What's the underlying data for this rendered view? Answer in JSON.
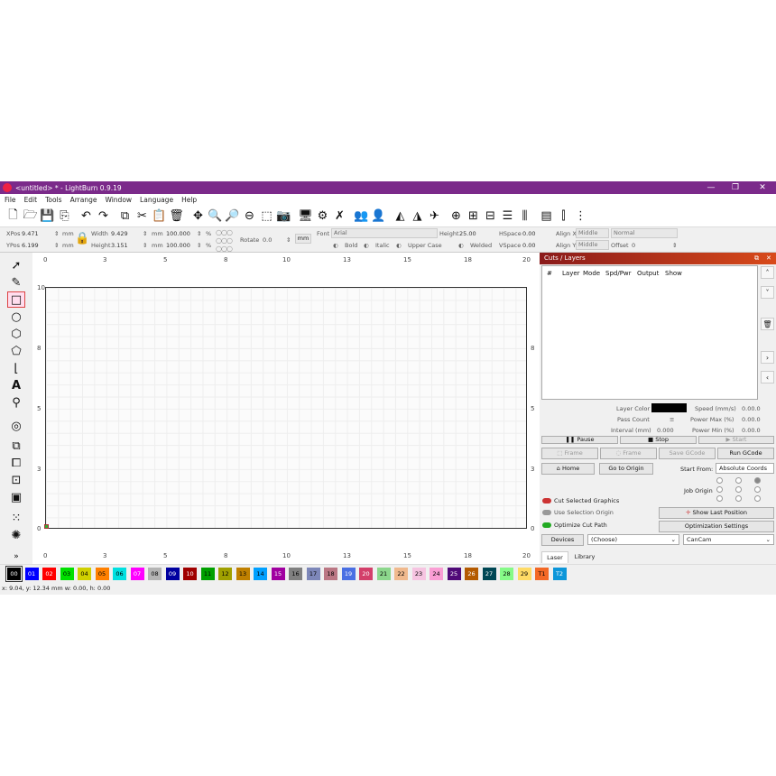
{
  "window": {
    "title": "<untitled> * - LightBurn 0.9.19",
    "minimize": "—",
    "restore": "❐",
    "close": "✕"
  },
  "menu": [
    "File",
    "Edit",
    "Tools",
    "Arrange",
    "Window",
    "Language",
    "Help"
  ],
  "toolbar_icons": [
    "new-file-icon",
    "open-folder-icon",
    "save-icon",
    "save-as-icon",
    "undo-icon",
    "redo-icon",
    "copy-icon",
    "cut-icon",
    "paste-icon",
    "delete-icon",
    "move-icon",
    "zoom-in-icon",
    "zoom-out-icon",
    "zoom-fit-icon",
    "zoom-frame-icon",
    "camera-icon",
    "monitor-icon",
    "settings-icon",
    "tools-icon",
    "users-icon",
    "user-icon",
    "mirror-h-icon",
    "mirror-v-icon",
    "send-icon",
    "target-icon",
    "align-icon",
    "distribute-icon",
    "align-center-icon",
    "align-middle-icon",
    "group-icon",
    "dock-icon",
    "center-icon"
  ],
  "props": {
    "xpos_label": "XPos",
    "xpos": "9.471",
    "ypos_label": "YPos",
    "ypos": "6.199",
    "unit": "mm",
    "width_label": "Width",
    "width": "9.429",
    "height_label": "Height",
    "height": "3.151",
    "scale_w": "100.000",
    "scale_h": "100.000",
    "pct": "%",
    "rotate_label": "Rotate",
    "rotate": "0.0",
    "unit_button": "mm",
    "font_label": "Font",
    "font": "Arial",
    "text_height_label": "Height",
    "text_height": "25.00",
    "hspace_label": "HSpace",
    "hspace": "0.00",
    "vspace_label": "VSpace",
    "vspace": "0.00",
    "alignx_label": "Align X",
    "alignx": "Middle",
    "aligny_label": "Align Y",
    "aligny": "Middle",
    "normal": "Normal",
    "offset_label": "Offset",
    "offset": "0",
    "bold": "Bold",
    "italic": "Italic",
    "upper": "Upper Case",
    "welded": "Welded"
  },
  "left_tools": [
    "select-icon",
    "edit-nodes-icon",
    "rectangle-icon",
    "ellipse-icon",
    "polygon-icon",
    "pentagon-icon",
    "bracket-icon",
    "text-icon",
    "position-icon",
    "offset-icon",
    "boolean-union-icon",
    "boolean-diff-icon",
    "boolean-intersect-icon",
    "weld-icon",
    "grid-array-icon",
    "circular-array-icon",
    "more-icon"
  ],
  "ruler_top": [
    "0",
    "3",
    "5",
    "8",
    "10",
    "13",
    "15",
    "18",
    "20"
  ],
  "ruler_bottom": [
    "0",
    "3",
    "5",
    "8",
    "10",
    "13",
    "15",
    "18",
    "20"
  ],
  "ruler_left": [
    "10",
    "8",
    "5",
    "3",
    "0"
  ],
  "ruler_right": [
    "8",
    "5",
    "3",
    "0"
  ],
  "cuts": {
    "title": "Cuts / Layers",
    "columns": [
      "#",
      "Layer",
      "Mode",
      "Spd/Pwr",
      "Output",
      "Show"
    ],
    "layer_color": "Layer Color",
    "pass_count": "Pass Count",
    "pass_val": "≡",
    "interval": "Interval (mm)",
    "interval_val": "0.000",
    "speed": "Speed (mm/s)",
    "speed_val": "0.00.0",
    "pmax": "Power Max (%)",
    "pmax_val": "0.00.0",
    "pmin": "Power Min (%)",
    "pmin_val": "0.00.0",
    "pause": "Pause",
    "stop": "Stop",
    "start": "Start",
    "frame1": "Frame",
    "frame2": "Frame",
    "save_gcode": "Save GCode",
    "run_gcode": "Run GCode",
    "home": "Home",
    "goto_origin": "Go to Origin",
    "start_from": "Start From:",
    "start_from_val": "Absolute Coords",
    "job_origin": "Job Origin",
    "cut_selected": "Cut Selected Graphics",
    "use_selection": "Use Selection Origin",
    "optimize": "Optimize Cut Path",
    "show_last": "Show Last Position",
    "opt_settings": "Optimization Settings",
    "devices": "Devices",
    "choose": "(Choose)",
    "device_name": "CanCam",
    "tab_laser": "Laser",
    "tab_library": "Library"
  },
  "palette": [
    {
      "label": "00",
      "color": "#000000",
      "text": "#ffffff"
    },
    {
      "label": "01",
      "color": "#0000ff",
      "text": "#ffffff"
    },
    {
      "label": "02",
      "color": "#ff0000",
      "text": "#ffffff"
    },
    {
      "label": "03",
      "color": "#00e000",
      "text": "#000000"
    },
    {
      "label": "04",
      "color": "#d0d000",
      "text": "#000000"
    },
    {
      "label": "05",
      "color": "#ff8000",
      "text": "#000000"
    },
    {
      "label": "06",
      "color": "#00e0e0",
      "text": "#000000"
    },
    {
      "label": "07",
      "color": "#ff00ff",
      "text": "#ffffff"
    },
    {
      "label": "08",
      "color": "#b4b4b4",
      "text": "#000000"
    },
    {
      "label": "09",
      "color": "#0000a0",
      "text": "#ffffff"
    },
    {
      "label": "10",
      "color": "#a00000",
      "text": "#ffffff"
    },
    {
      "label": "11",
      "color": "#00a000",
      "text": "#000000"
    },
    {
      "label": "12",
      "color": "#a0a000",
      "text": "#000000"
    },
    {
      "label": "13",
      "color": "#c08000",
      "text": "#000000"
    },
    {
      "label": "14",
      "color": "#00a0ff",
      "text": "#000000"
    },
    {
      "label": "15",
      "color": "#a000a0",
      "text": "#ffffff"
    },
    {
      "label": "16",
      "color": "#808080",
      "text": "#000000"
    },
    {
      "label": "17",
      "color": "#7d87b9",
      "text": "#000000"
    },
    {
      "label": "18",
      "color": "#bb7784",
      "text": "#000000"
    },
    {
      "label": "19",
      "color": "#4a6fe3",
      "text": "#ffffff"
    },
    {
      "label": "20",
      "color": "#d33f6a",
      "text": "#ffffff"
    },
    {
      "label": "21",
      "color": "#8cd78c",
      "text": "#000000"
    },
    {
      "label": "22",
      "color": "#f0b98d",
      "text": "#000000"
    },
    {
      "label": "23",
      "color": "#f6c4e1",
      "text": "#000000"
    },
    {
      "label": "24",
      "color": "#fa9ed4",
      "text": "#000000"
    },
    {
      "label": "25",
      "color": "#500a78",
      "text": "#ffffff"
    },
    {
      "label": "26",
      "color": "#b45a00",
      "text": "#ffffff"
    },
    {
      "label": "27",
      "color": "#004754",
      "text": "#ffffff"
    },
    {
      "label": "28",
      "color": "#86fa88",
      "text": "#000000"
    },
    {
      "label": "29",
      "color": "#ffdb66",
      "text": "#000000"
    },
    {
      "label": "T1",
      "color": "#f36926",
      "text": "#000000"
    },
    {
      "label": "T2",
      "color": "#0c96d9",
      "text": "#ffffff"
    }
  ],
  "status": {
    "text": "x: 9.04, y: 12.34 mm  w: 0.00,  h: 0.00"
  }
}
